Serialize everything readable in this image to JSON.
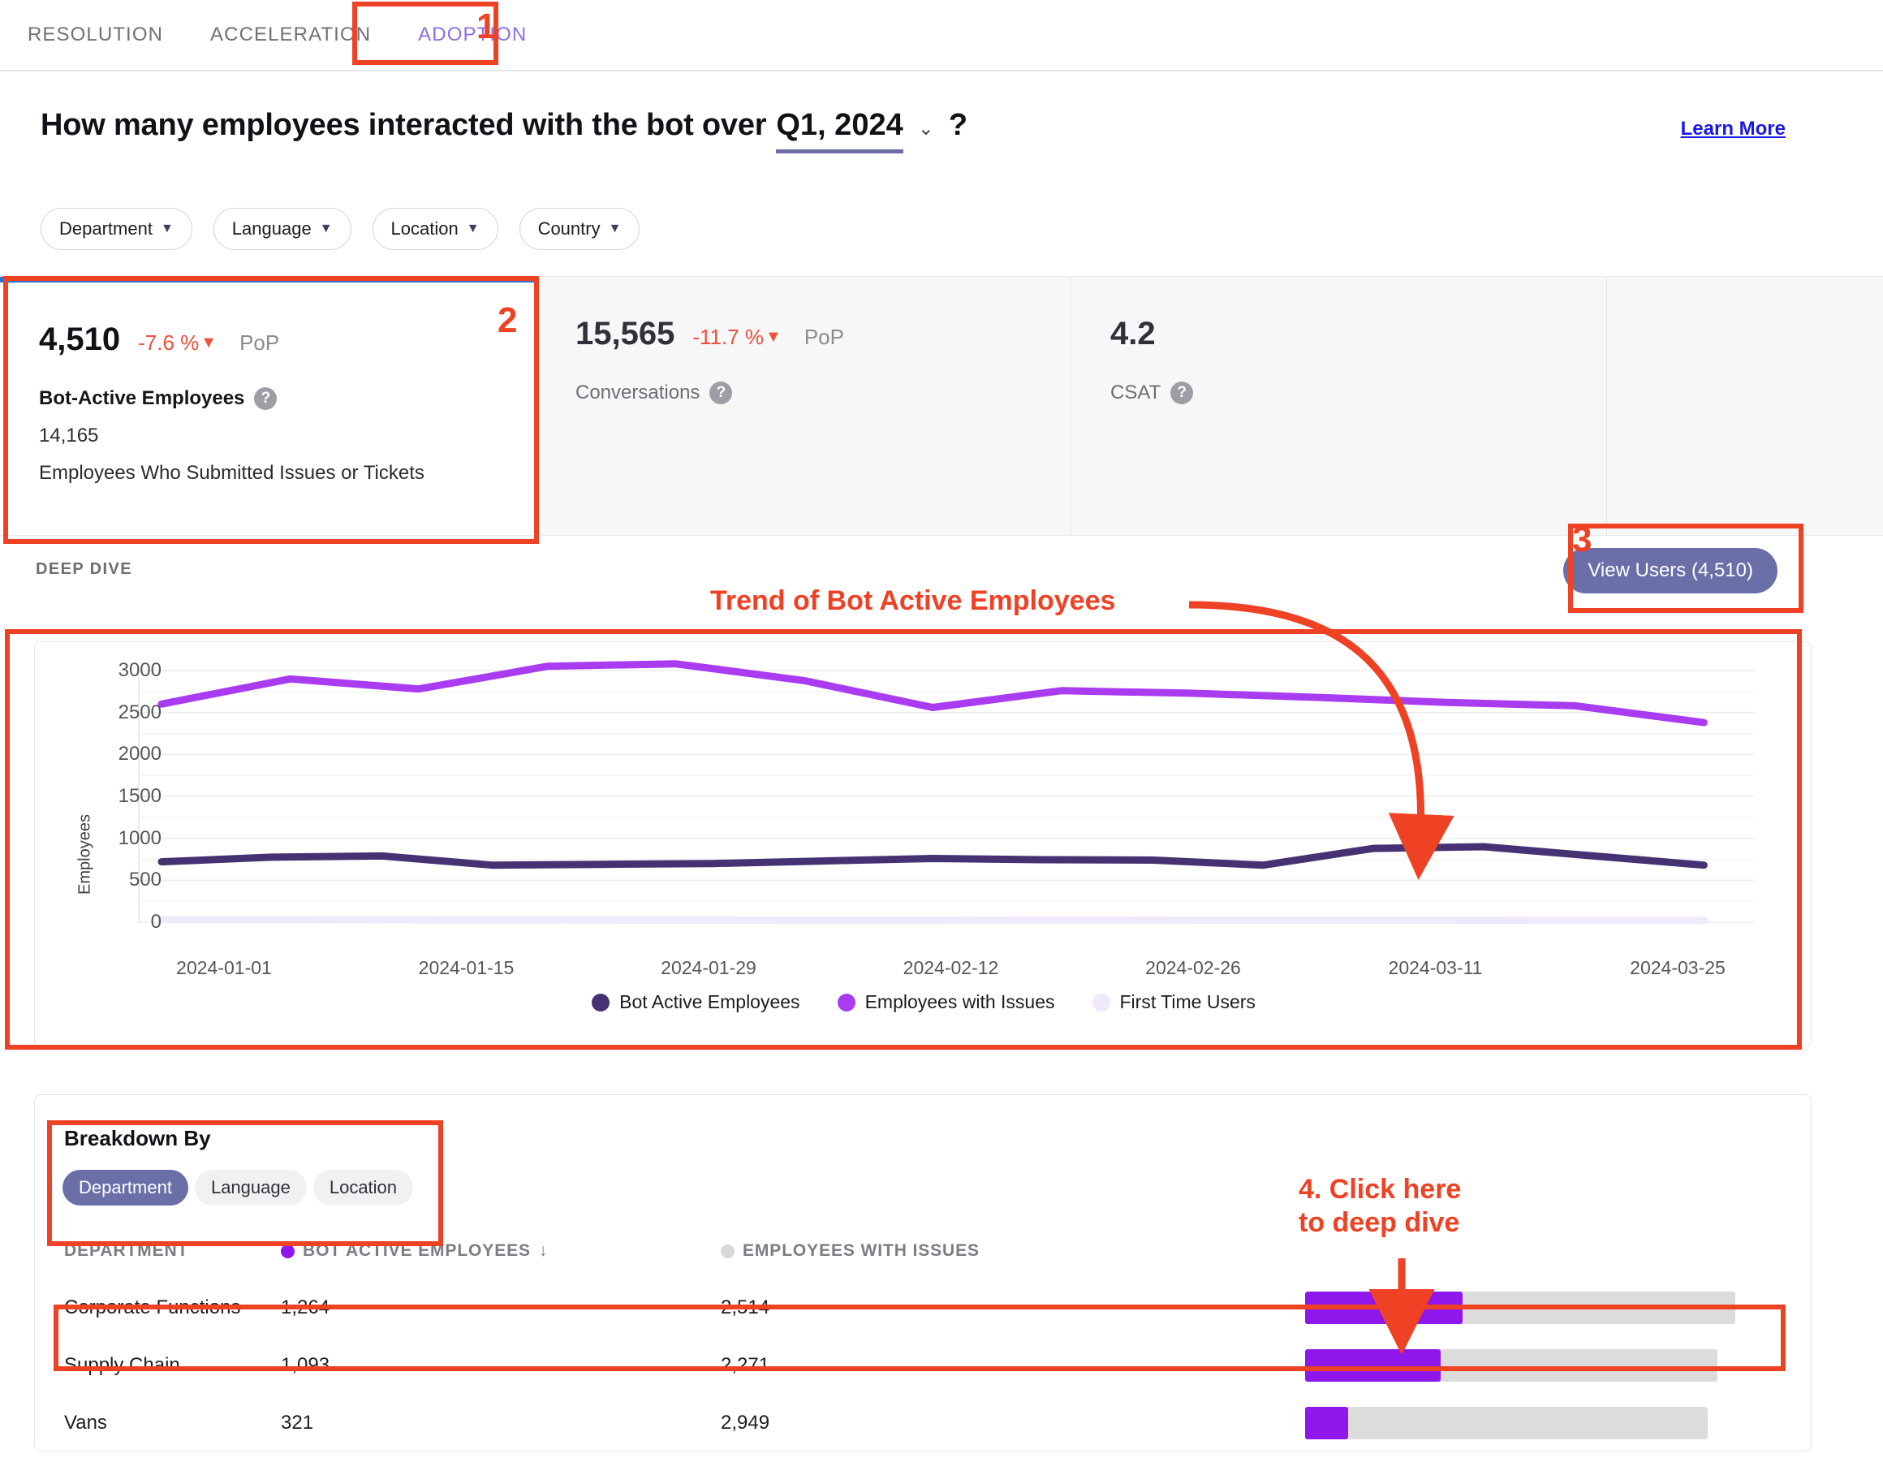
{
  "tabs": [
    {
      "label": "RESOLUTION",
      "active": false
    },
    {
      "label": "ACCELERATION",
      "active": false
    },
    {
      "label": "ADOPTION",
      "active": true
    }
  ],
  "header": {
    "question_prefix": "How many employees interacted with the bot over",
    "period": "Q1, 2024",
    "caret": "⌄",
    "question_mark": "?",
    "learn_more": "Learn More"
  },
  "filters": [
    {
      "label": "Department"
    },
    {
      "label": "Language"
    },
    {
      "label": "Location"
    },
    {
      "label": "Country"
    }
  ],
  "kpis": [
    {
      "value": "4,510",
      "delta": "-7.6 %",
      "delta_arrow": "▼",
      "pop": "PoP",
      "label": "Bot-Active Employees",
      "help": "?",
      "sub_value": "14,165",
      "sub_label": "Employees Who Submitted Issues or Tickets",
      "selected": true
    },
    {
      "value": "15,565",
      "delta": "-11.7 %",
      "delta_arrow": "▼",
      "pop": "PoP",
      "label": "Conversations",
      "help": "?",
      "selected": false
    },
    {
      "value": "4.2",
      "delta": "",
      "delta_arrow": "",
      "pop": "",
      "label": "CSAT",
      "help": "?",
      "selected": false
    }
  ],
  "deep_dive": {
    "section_label": "DEEP DIVE",
    "view_users_button": "View Users (4,510)"
  },
  "chart_data": {
    "type": "line",
    "title": "",
    "xlabel": "",
    "ylabel": "Employees",
    "ylim": [
      0,
      3000
    ],
    "yticks": [
      0,
      500,
      1000,
      1500,
      2000,
      2500,
      3000
    ],
    "grid": true,
    "legend_position": "bottom",
    "x": [
      "2024-01-01",
      "2024-01-08",
      "2024-01-15",
      "2024-01-22",
      "2024-01-29",
      "2024-02-05",
      "2024-02-12",
      "2024-02-19",
      "2024-02-26",
      "2024-03-04",
      "2024-03-11",
      "2024-03-18",
      "2024-03-25"
    ],
    "xtick_labels": [
      "2024-01-01",
      "2024-01-15",
      "2024-01-29",
      "2024-02-12",
      "2024-02-26",
      "2024-03-11",
      "2024-03-25"
    ],
    "series": [
      {
        "name": "Bot Active Employees",
        "color": "#463272",
        "values": [
          720,
          775,
          790,
          680,
          690,
          700,
          730,
          760,
          745,
          740,
          680,
          880,
          900,
          790,
          680
        ]
      },
      {
        "name": "Employees with Issues",
        "color": "#a93cf0",
        "values": [
          2600,
          2900,
          2780,
          3050,
          3080,
          2880,
          2560,
          2760,
          2730,
          2680,
          2620,
          2580,
          2380
        ]
      },
      {
        "name": "First Time Users",
        "color": "#f0e8fb",
        "values": [
          30,
          30,
          28,
          26,
          25,
          24,
          24,
          23,
          22,
          22,
          21,
          20,
          20
        ]
      }
    ]
  },
  "breakdown": {
    "title": "Breakdown By",
    "options": [
      {
        "label": "Department",
        "active": true
      },
      {
        "label": "Language",
        "active": false
      },
      {
        "label": "Location",
        "active": false
      }
    ],
    "columns": [
      "DEPARTMENT",
      "BOT ACTIVE EMPLOYEES",
      "EMPLOYEES WITH ISSUES"
    ],
    "sort_indicator": "↓",
    "bar_colors": {
      "fill": "#9017ec",
      "track": "#dcdcdc"
    },
    "rows": [
      {
        "department": "Corporate Functions",
        "bot_active": "1,264",
        "with_issues": "2,514",
        "bar_pct": 38,
        "track_pct": 100,
        "highlighted": true
      },
      {
        "department": "Supply Chain",
        "bot_active": "1,093",
        "with_issues": "2,271",
        "bar_pct": 33,
        "track_pct": 85,
        "highlighted": false
      },
      {
        "department": "Vans",
        "bot_active": "321",
        "with_issues": "2,949",
        "bar_pct": 10,
        "track_pct": 82,
        "highlighted": false
      }
    ]
  },
  "annotations": {
    "n1": "1",
    "n2": "2",
    "n3": "3",
    "trend_label": "Trend of Bot Active Employees",
    "click_label": "4. Click here\nto deep dive",
    "color": "#ef4123"
  }
}
